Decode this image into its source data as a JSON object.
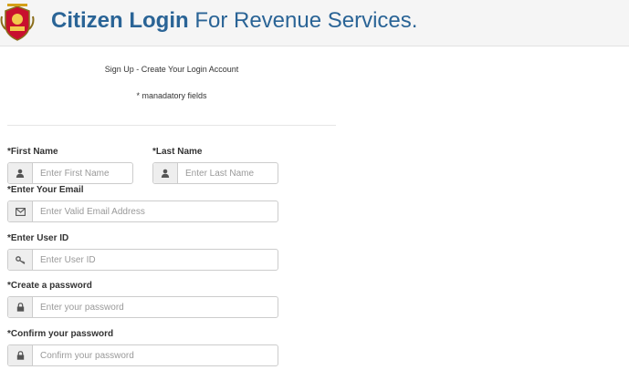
{
  "header": {
    "title_strong": "Citizen Login",
    "title_rest": "For Revenue Services."
  },
  "form": {
    "subtitle": "Sign Up - Create Your Login Account",
    "mandatory_note": "* manadatory fields",
    "first_name": {
      "label": "*First Name",
      "placeholder": "Enter First Name",
      "value": "",
      "icon": "user-icon"
    },
    "last_name": {
      "label": "*Last Name",
      "placeholder": "Enter Last Name",
      "value": "",
      "icon": "user-icon"
    },
    "email": {
      "label": "*Enter Your Email",
      "placeholder": "Enter Valid Email Address",
      "value": "",
      "icon": "envelope-icon"
    },
    "user_id": {
      "label": "*Enter User ID",
      "placeholder": "Enter User ID",
      "value": "",
      "icon": "key-icon"
    },
    "password": {
      "label": "*Create a password",
      "placeholder": "Enter your password",
      "value": "",
      "icon": "lock-icon"
    },
    "confirm_password": {
      "label": "*Confirm your password",
      "placeholder": "Confirm your password",
      "value": "",
      "icon": "lock-icon"
    }
  },
  "colors": {
    "title": "#2a6496",
    "header_bg": "#f5f5f5",
    "addon_bg": "#eeeeee",
    "input_border": "#cccccc"
  }
}
